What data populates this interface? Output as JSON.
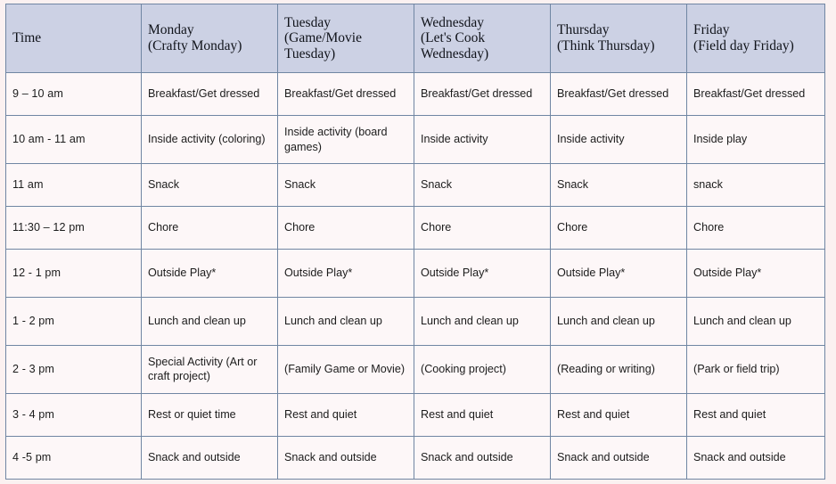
{
  "table": {
    "columns": [
      {
        "key": "time",
        "header_name": "Time",
        "header_theme": ""
      },
      {
        "key": "monday",
        "header_name": "Monday",
        "header_theme": "(Crafty Monday)"
      },
      {
        "key": "tuesday",
        "header_name": "Tuesday",
        "header_theme": "(Game/Movie Tuesday)"
      },
      {
        "key": "wednesday",
        "header_name": "Wednesday",
        "header_theme": " (Let's Cook Wednesday)"
      },
      {
        "key": "thursday",
        "header_name": "Thursday",
        "header_theme": " (Think Thursday)"
      },
      {
        "key": "friday",
        "header_name": "Friday",
        "header_theme": "(Field day Friday)"
      }
    ],
    "rows": [
      {
        "time": "9 – 10 am",
        "monday": "Breakfast/Get dressed",
        "tuesday": "Breakfast/Get dressed",
        "wednesday": "Breakfast/Get dressed",
        "thursday": "Breakfast/Get dressed",
        "friday": "Breakfast/Get dressed"
      },
      {
        "time": "10 am  - 11 am",
        "monday": "Inside activity (coloring)",
        "tuesday": "Inside activity (board games)",
        "wednesday": "Inside activity",
        "thursday": "Inside activity",
        "friday": "Inside play"
      },
      {
        "time": "11 am",
        "monday": "Snack",
        "tuesday": " Snack",
        "wednesday": "Snack",
        "thursday": "Snack",
        "friday": "snack"
      },
      {
        "time": "11:30 – 12 pm",
        "monday": "Chore",
        "tuesday": "Chore",
        "wednesday": "Chore",
        "thursday": "Chore",
        "friday": "Chore"
      },
      {
        "time": "12 - 1 pm",
        "monday": "Outside Play*",
        "tuesday": "Outside Play*",
        "wednesday": "Outside Play*",
        "thursday": "Outside Play*",
        "friday": "Outside Play*"
      },
      {
        "time": "1 - 2 pm",
        "monday": "Lunch and clean up",
        "tuesday": "Lunch and clean up",
        "wednesday": "Lunch and clean up",
        "thursday": "Lunch and clean up",
        "friday": "Lunch and clean up"
      },
      {
        "time": "2 - 3 pm",
        "monday": "Special Activity (Art or craft project)",
        "tuesday": "(Family Game or Movie)",
        "wednesday": "(Cooking project)",
        "thursday": "(Reading or writing)",
        "friday": "(Park or field trip)"
      },
      {
        "time": "3 - 4 pm",
        "monday": "Rest or quiet time",
        "tuesday": "Rest and quiet",
        "wednesday": "Rest and quiet",
        "thursday": "Rest and quiet",
        "friday": "Rest and quiet"
      },
      {
        "time": "4 -5 pm",
        "monday": "Snack and outside",
        "tuesday": " Snack and outside",
        "wednesday": "Snack and outside",
        "thursday": "Snack and outside",
        "friday": "Snack and outside"
      }
    ]
  },
  "style": {
    "header_fill": "#ccd1e4",
    "border_color": "#7086a3",
    "cell_fill": "#fdf7f8",
    "page_background": "#fbf1f1",
    "text_color": "#1c1c1c"
  }
}
